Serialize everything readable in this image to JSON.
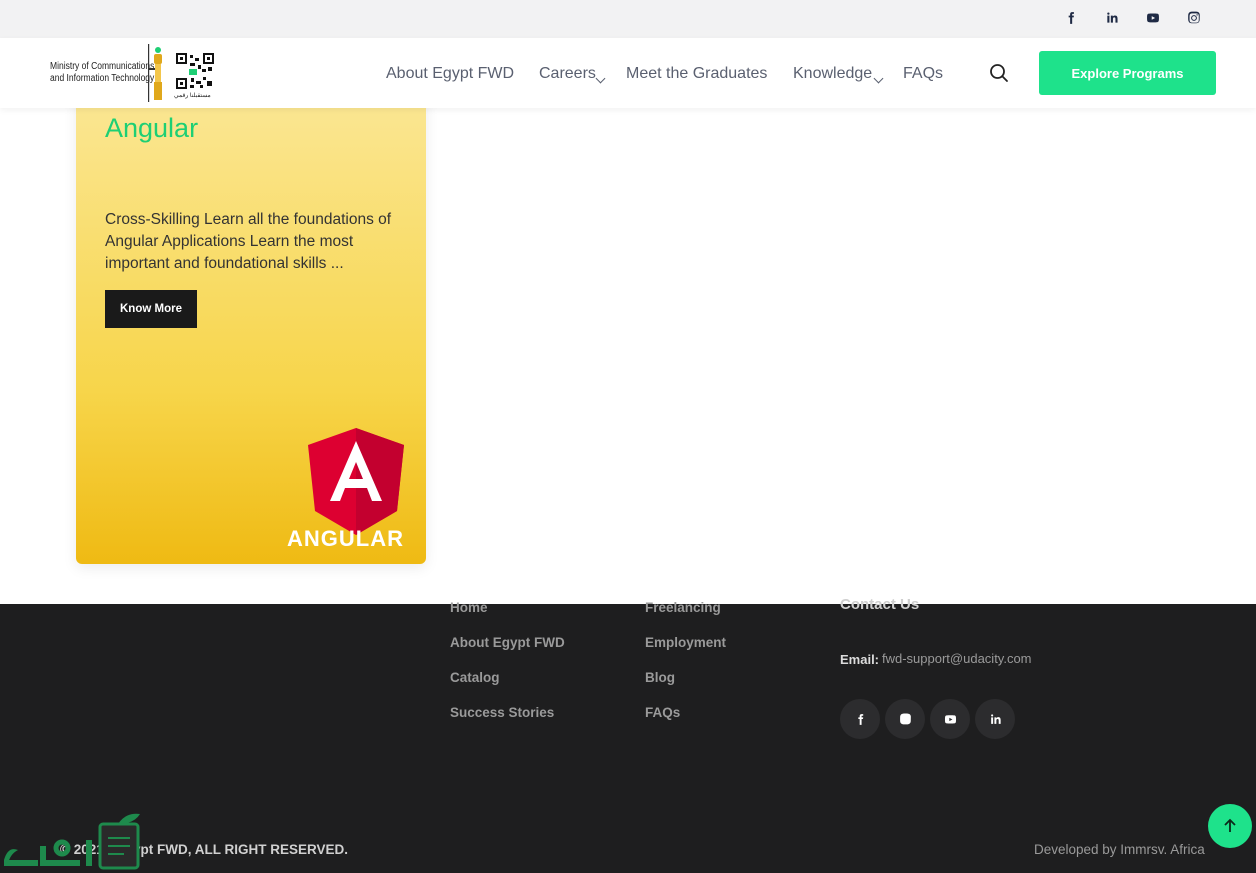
{
  "topbar": {
    "social": [
      "facebook-icon",
      "linkedin-icon",
      "youtube-icon",
      "instagram-icon"
    ]
  },
  "logo": {
    "ministry_line1": "Ministry of Communications",
    "ministry_line2": "and Information Technology",
    "qr_caption": "مستقبلنا رقمي"
  },
  "nav": {
    "items": [
      "About Egypt FWD",
      "Careers",
      "Meet the Graduates",
      "Knowledge",
      "FAQs"
    ],
    "explore_label": "Explore Programs"
  },
  "card": {
    "title": "Angular",
    "description": "Cross-Skilling Learn all the foundations of Angular Applications  Learn the most important and foundational skills ...",
    "button_label": "Know More",
    "logo_word": "ANGULAR"
  },
  "footer": {
    "col1": [
      "Home",
      "About Egypt FWD",
      "Catalog",
      "Success Stories"
    ],
    "col2": [
      "Freelancing",
      "Employment",
      "Blog",
      "FAQs"
    ],
    "contact_heading": "Contact Us",
    "email_label": "Email:",
    "email_value": "fwd-support@udacity.com",
    "social": [
      "facebook-icon",
      "instagram-icon",
      "youtube-icon",
      "linkedin-icon"
    ],
    "copyright": "© 2021 - Egypt FWD, ALL RIGHT RESERVED.",
    "developer": "Developed by Immrsv. Africa"
  },
  "colors": {
    "accent_green": "#1ee28b",
    "title_green": "#1ecf74",
    "footer_bg": "#1e1e1f",
    "card_yellow": "#f7d54a"
  }
}
